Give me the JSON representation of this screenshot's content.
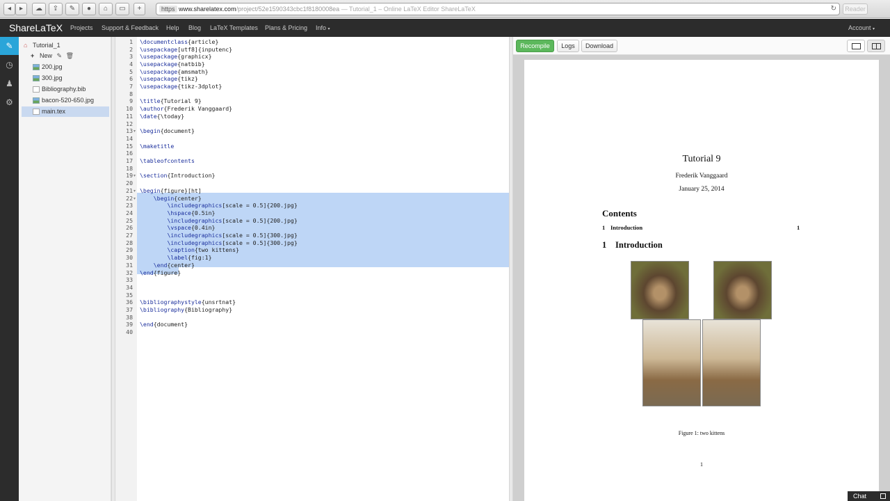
{
  "browser": {
    "url_protocol": "https",
    "url_host": "www.sharelatex.com",
    "url_path": "/project/52e1590343cbc1f8180008ea",
    "page_title": " — Tutorial_1 – Online LaTeX Editor ShareLaTeX",
    "reader_label": "Reader"
  },
  "navbar": {
    "brand": "ShareLaTeX",
    "links": [
      "Projects",
      "Support & Feedback",
      "Help",
      "Blog",
      "LaTeX Templates",
      "Plans & Pricing",
      "Info"
    ],
    "account": "Account"
  },
  "filetree": {
    "project": "Tutorial_1",
    "new_label": "New",
    "files": [
      "200.jpg",
      "300.jpg",
      "Bibliography.bib",
      "bacon-520-650.jpg",
      "main.tex"
    ],
    "selected": "main.tex"
  },
  "editor": {
    "lines": [
      "\\documentclass{article}",
      "\\usepackage[utf8]{inputenc}",
      "\\usepackage{graphicx}",
      "\\usepackage{natbib}",
      "\\usepackage{amsmath}",
      "\\usepackage{tikz}",
      "\\usepackage{tikz-3dplot}",
      "",
      "\\title{Tutorial 9}",
      "\\author{Frederik Vanggaard}",
      "\\date{\\today}",
      "",
      "\\begin{document}",
      "",
      "\\maketitle",
      "",
      "\\tableofcontents",
      "",
      "\\section{Introduction}",
      "",
      "\\begin{figure}[ht]",
      "    \\begin{center}",
      "        \\includegraphics[scale = 0.5]{200.jpg}",
      "        \\hspace{0.5in}",
      "        \\includegraphics[scale = 0.5]{200.jpg}",
      "        \\vspace{0.4in}",
      "        \\includegraphics[scale = 0.5]{300.jpg}",
      "        \\includegraphics[scale = 0.5]{300.jpg}",
      "        \\caption{two kittens}",
      "        \\label{fig:1}",
      "    \\end{center}",
      "\\end{figure}",
      "",
      "",
      "",
      "\\bibliographystyle{unsrtnat}",
      "\\bibliography{Bibliography}",
      "",
      "\\end{document}",
      ""
    ],
    "fold_lines": [
      13,
      19,
      21,
      22
    ],
    "selection_lines": "22-32"
  },
  "pdf_toolbar": {
    "recompile": "Recompile",
    "logs": "Logs",
    "download": "Download"
  },
  "pdf": {
    "title": "Tutorial 9",
    "author": "Frederik Vanggaard",
    "date": "January 25, 2014",
    "contents_heading": "Contents",
    "toc_num": "1",
    "toc_entry": "Introduction",
    "toc_page": "1",
    "section_num": "1",
    "section_title": "Introduction",
    "caption": "Figure 1: two kittens",
    "page_number": "1"
  },
  "chat_label": "Chat"
}
